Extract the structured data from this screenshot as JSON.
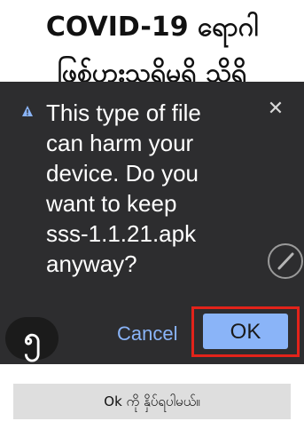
{
  "headline": {
    "line1": "COVID-19 ရောဂါ",
    "line2": "ဖြစ်ပွားသူရှိမရှိ သိရှိ"
  },
  "dialog": {
    "warning_icon": "warning-triangle-icon",
    "message": "This type of file\ncan harm your\ndevice. Do you\nwant to keep\nsss-1.1.21.apk\nanyway?",
    "close_icon": "close-icon",
    "cancel_label": "Cancel",
    "ok_label": "OK",
    "accent_color": "#8ab4f8",
    "background_color": "#2d2d2f"
  },
  "step_badge": "၅",
  "highlight_color": "#e2231a",
  "caption": "Ok ကို နှိပ်ရပါမယ်။"
}
